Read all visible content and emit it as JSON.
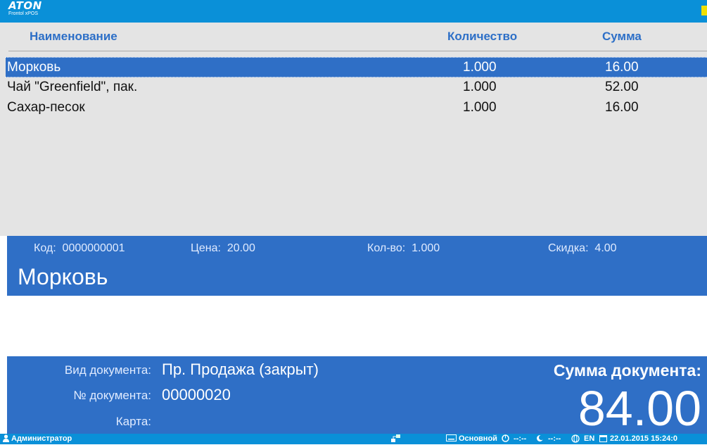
{
  "app": {
    "logo_text": "ATON",
    "logo_subtitle": "Frontol xPOS"
  },
  "table": {
    "headers": {
      "name": "Наименование",
      "quantity": "Количество",
      "sum": "Сумма"
    },
    "rows": [
      {
        "name": "Морковь",
        "quantity": "1.000",
        "sum": "16.00",
        "selected": true
      },
      {
        "name": "Чай \"Greenfield\", пак.",
        "quantity": "1.000",
        "sum": "52.00",
        "selected": false
      },
      {
        "name": "Сахар-песок",
        "quantity": "1.000",
        "sum": "16.00",
        "selected": false
      }
    ]
  },
  "item_info": {
    "code_label": "Код:",
    "code": "0000000001",
    "price_label": "Цена:",
    "price": "20.00",
    "qty_label": "Кол-во:",
    "qty": "1.000",
    "discount_label": "Скидка:",
    "discount": "4.00",
    "name": "Морковь"
  },
  "document": {
    "type_label": "Вид документа:",
    "type": "Пр. Продажа (закрыт)",
    "number_label": "№ документа:",
    "number": "00000020",
    "card_label": "Карта:",
    "card": "",
    "total_label": "Сумма документа:",
    "total": "84.00"
  },
  "status_bar": {
    "user": "Администратор",
    "layout": "Основной",
    "time1": "--:--",
    "time2": "--:--",
    "lang": "EN",
    "datetime": "22.01.2015 15:24:0"
  },
  "colors": {
    "top_bar": "#0a90d8",
    "panel": "#2f6fc6",
    "header_text": "#2d6fc7"
  }
}
